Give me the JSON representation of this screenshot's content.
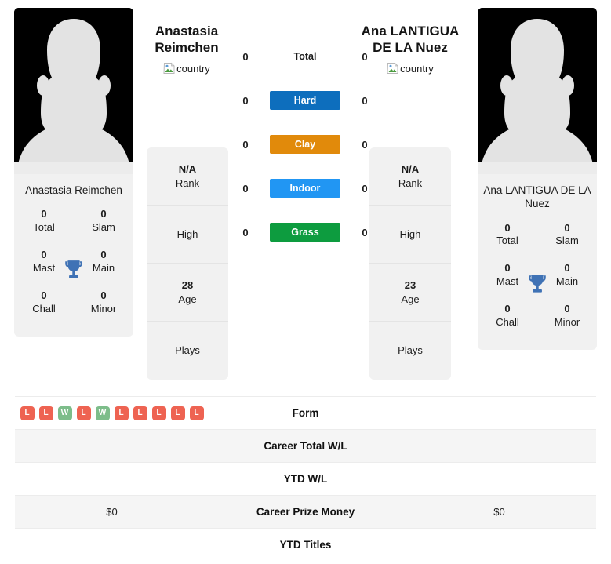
{
  "players": [
    {
      "header_name": "Anastasia Reimchen",
      "card_name": "Anastasia Reimchen",
      "country_alt": "country",
      "titles": [
        {
          "value": "0",
          "label": "Total"
        },
        {
          "value": "0",
          "label": "Slam"
        },
        {
          "value": "0",
          "label": "Mast"
        },
        {
          "value": "0",
          "label": "Main"
        },
        {
          "value": "0",
          "label": "Chall"
        },
        {
          "value": "0",
          "label": "Minor"
        }
      ],
      "info": [
        {
          "value": "N/A",
          "label": "Rank"
        },
        {
          "value": "",
          "label": "High"
        },
        {
          "value": "28",
          "label": "Age"
        },
        {
          "value": "",
          "label": "Plays"
        }
      ],
      "surface_scores": [
        "0",
        "0",
        "0",
        "0",
        "0"
      ],
      "form": [
        "L",
        "L",
        "W",
        "L",
        "W",
        "L",
        "L",
        "L",
        "L",
        "L"
      ],
      "career_total_wl": "",
      "ytd_wl": "",
      "career_prize_money": "$0",
      "ytd_titles": ""
    },
    {
      "header_name": "Ana LANTIGUA DE LA Nuez",
      "card_name": "Ana LANTIGUA DE LA Nuez",
      "country_alt": "country",
      "titles": [
        {
          "value": "0",
          "label": "Total"
        },
        {
          "value": "0",
          "label": "Slam"
        },
        {
          "value": "0",
          "label": "Mast"
        },
        {
          "value": "0",
          "label": "Main"
        },
        {
          "value": "0",
          "label": "Chall"
        },
        {
          "value": "0",
          "label": "Minor"
        }
      ],
      "info": [
        {
          "value": "N/A",
          "label": "Rank"
        },
        {
          "value": "",
          "label": "High"
        },
        {
          "value": "23",
          "label": "Age"
        },
        {
          "value": "",
          "label": "Plays"
        }
      ],
      "surface_scores": [
        "0",
        "0",
        "0",
        "0",
        "0"
      ],
      "form": [],
      "career_total_wl": "",
      "ytd_wl": "",
      "career_prize_money": "$0",
      "ytd_titles": ""
    }
  ],
  "surfaces": [
    {
      "name": "Total",
      "color": "",
      "plain": true
    },
    {
      "name": "Hard",
      "color": "#0d6ebd",
      "plain": false
    },
    {
      "name": "Clay",
      "color": "#e18a0b",
      "plain": false
    },
    {
      "name": "Indoor",
      "color": "#2196f3",
      "plain": false
    },
    {
      "name": "Grass",
      "color": "#0d9c3f",
      "plain": false
    }
  ],
  "comparison_rows": [
    {
      "label": "Form",
      "left": "",
      "right": "",
      "striped": false,
      "type": "form"
    },
    {
      "label": "Career Total W/L",
      "left": "",
      "right": "",
      "striped": true,
      "type": "text"
    },
    {
      "label": "YTD W/L",
      "left": "",
      "right": "",
      "striped": false,
      "type": "text"
    },
    {
      "label": "Career Prize Money",
      "left": "$0",
      "right": "$0",
      "striped": true,
      "type": "text"
    },
    {
      "label": "YTD Titles",
      "left": "",
      "right": "",
      "striped": false,
      "type": "text"
    }
  ],
  "colors": {
    "form_win": "#7dbd8a",
    "form_loss": "#ee6352",
    "trophy": "#3f72b5",
    "card_bg": "#f1f1f1",
    "stripe_bg": "#f5f5f5"
  }
}
